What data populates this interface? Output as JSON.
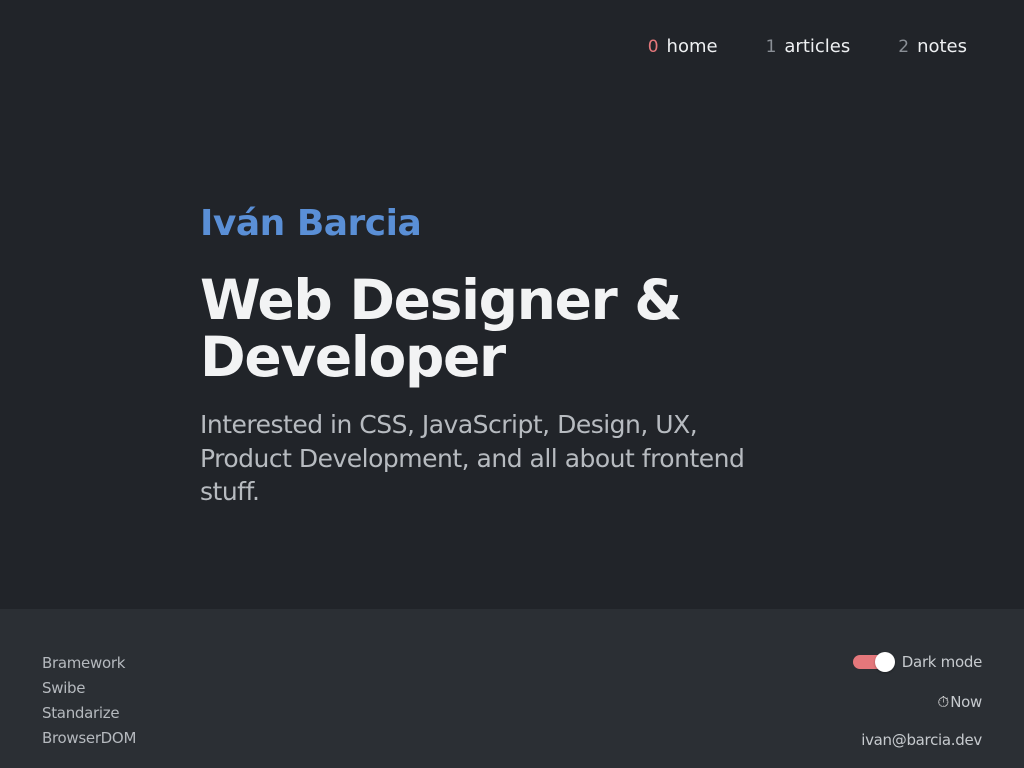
{
  "nav": {
    "items": [
      {
        "num": "0",
        "label": "home",
        "active": true
      },
      {
        "num": "1",
        "label": "articles",
        "active": false
      },
      {
        "num": "2",
        "label": "notes",
        "active": false
      }
    ]
  },
  "hero": {
    "name": "Iván Barcia",
    "title": "Web Designer & Developer",
    "description": "Interested in CSS, JavaScript, Design, UX, Product Development, and all about frontend stuff."
  },
  "footer": {
    "projects": [
      "Bramework",
      "Swibe",
      "Standarize",
      "BrowserDOM"
    ],
    "dark_mode_label": "Dark mode",
    "dark_mode_on": true,
    "now_icon": "stopwatch-icon",
    "now_label": "Now",
    "email": "ivan@barcia.dev"
  },
  "colors": {
    "background": "#212429",
    "footer_background": "#2b2f34",
    "accent_blue": "#5a8fd6",
    "accent_red": "#e4777b"
  }
}
